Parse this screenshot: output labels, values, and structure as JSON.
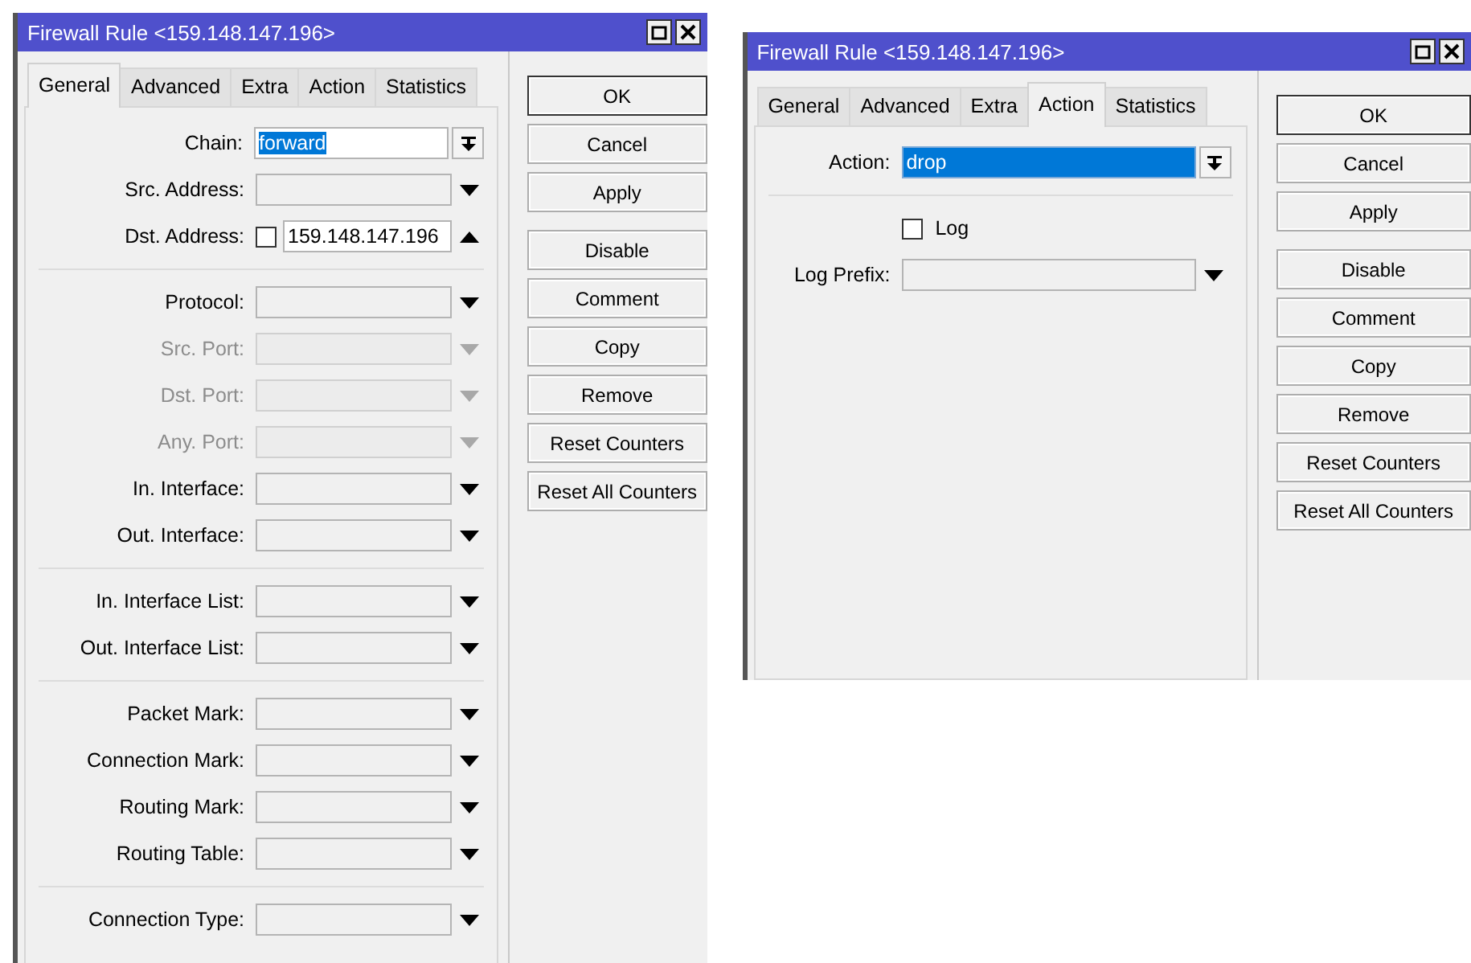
{
  "windows": [
    {
      "title": "Firewall Rule <159.148.147.196>",
      "tabs": [
        {
          "label": "General",
          "selected": true
        },
        {
          "label": "Advanced",
          "selected": false
        },
        {
          "label": "Extra",
          "selected": false
        },
        {
          "label": "Action",
          "selected": false
        },
        {
          "label": "Statistics",
          "selected": false
        }
      ],
      "sections": [
        [
          {
            "kind": "combo",
            "label": "Chain:",
            "value": "forward",
            "value_selected": true
          },
          {
            "kind": "dropdown",
            "label": "Src. Address:",
            "disabled": false,
            "expanded": false
          },
          {
            "kind": "negatable",
            "label": "Dst. Address:",
            "value": "159.148.147.196",
            "negated": false,
            "expanded": true
          }
        ],
        [
          {
            "kind": "dropdown",
            "label": "Protocol:",
            "disabled": false,
            "expanded": false
          },
          {
            "kind": "dropdown",
            "label": "Src. Port:",
            "disabled": true,
            "expanded": false
          },
          {
            "kind": "dropdown",
            "label": "Dst. Port:",
            "disabled": true,
            "expanded": false
          },
          {
            "kind": "dropdown",
            "label": "Any. Port:",
            "disabled": true,
            "expanded": false
          },
          {
            "kind": "dropdown",
            "label": "In. Interface:",
            "disabled": false,
            "expanded": false
          },
          {
            "kind": "dropdown",
            "label": "Out. Interface:",
            "disabled": false,
            "expanded": false
          }
        ],
        [
          {
            "kind": "dropdown",
            "label": "In. Interface List:",
            "disabled": false,
            "expanded": false
          },
          {
            "kind": "dropdown",
            "label": "Out. Interface List:",
            "disabled": false,
            "expanded": false
          }
        ],
        [
          {
            "kind": "dropdown",
            "label": "Packet Mark:",
            "disabled": false,
            "expanded": false
          },
          {
            "kind": "dropdown",
            "label": "Connection Mark:",
            "disabled": false,
            "expanded": false
          },
          {
            "kind": "dropdown",
            "label": "Routing Mark:",
            "disabled": false,
            "expanded": false
          },
          {
            "kind": "dropdown",
            "label": "Routing Table:",
            "disabled": false,
            "expanded": false
          }
        ],
        [
          {
            "kind": "dropdown",
            "label": "Connection Type:",
            "disabled": false,
            "expanded": false
          }
        ]
      ],
      "button_groups": [
        [
          {
            "label": "OK",
            "default": true
          },
          {
            "label": "Cancel",
            "default": false
          },
          {
            "label": "Apply",
            "default": false
          }
        ],
        [
          {
            "label": "Disable",
            "default": false
          },
          {
            "label": "Comment",
            "default": false
          },
          {
            "label": "Copy",
            "default": false
          },
          {
            "label": "Remove",
            "default": false
          },
          {
            "label": "Reset Counters",
            "default": false
          },
          {
            "label": "Reset All Counters",
            "default": false
          }
        ]
      ]
    },
    {
      "title": "Firewall Rule <159.148.147.196>",
      "tabs": [
        {
          "label": "General",
          "selected": false
        },
        {
          "label": "Advanced",
          "selected": false
        },
        {
          "label": "Extra",
          "selected": false
        },
        {
          "label": "Action",
          "selected": true
        },
        {
          "label": "Statistics",
          "selected": false
        }
      ],
      "sections": [
        [
          {
            "kind": "select",
            "label": "Action:",
            "value": "drop",
            "value_selected": true
          }
        ],
        [
          {
            "kind": "checkbox",
            "label": "Log",
            "checked": false
          },
          {
            "kind": "dropdown",
            "label": "Log Prefix:",
            "disabled": false,
            "expanded": false
          }
        ]
      ],
      "button_groups": [
        [
          {
            "label": "OK",
            "default": true
          },
          {
            "label": "Cancel",
            "default": false
          },
          {
            "label": "Apply",
            "default": false
          }
        ],
        [
          {
            "label": "Disable",
            "default": false
          },
          {
            "label": "Comment",
            "default": false
          },
          {
            "label": "Copy",
            "default": false
          },
          {
            "label": "Remove",
            "default": false
          },
          {
            "label": "Reset Counters",
            "default": false
          },
          {
            "label": "Reset All Counters",
            "default": false
          }
        ]
      ]
    }
  ]
}
